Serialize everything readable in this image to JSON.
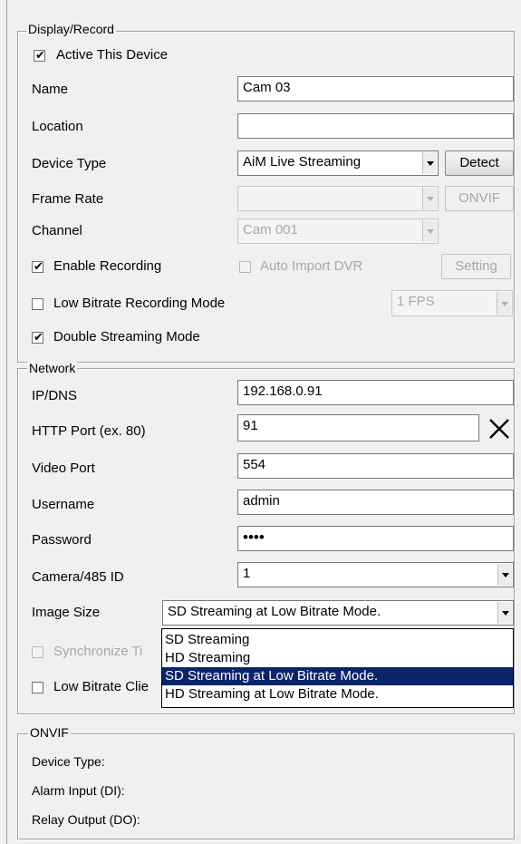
{
  "display_record": {
    "legend": "Display/Record",
    "active_device": {
      "label": "Active This Device",
      "checked": true
    },
    "name": {
      "label": "Name",
      "value": "Cam 03"
    },
    "location": {
      "label": "Location",
      "value": ""
    },
    "device_type": {
      "label": "Device Type",
      "value": "AiM Live Streaming",
      "detect_label": "Detect"
    },
    "frame_rate": {
      "label": "Frame Rate",
      "value": "",
      "onvif_label": "ONVIF"
    },
    "channel": {
      "label": "Channel",
      "value": "Cam 001"
    },
    "enable_recording": {
      "label": "Enable Recording",
      "checked": true
    },
    "auto_import": {
      "label": "Auto Import DVR",
      "checked": false
    },
    "setting_label": "Setting",
    "low_bitrate_recording": {
      "label": "Low Bitrate Recording Mode",
      "checked": false,
      "fps_value": "1 FPS"
    },
    "double_streaming": {
      "label": "Double Streaming Mode",
      "checked": true
    }
  },
  "network": {
    "legend": "Network",
    "ip": {
      "label": "IP/DNS",
      "value": "192.168.0.91"
    },
    "http_port": {
      "label": "HTTP Port (ex. 80)",
      "value": "91"
    },
    "video_port": {
      "label": "Video Port",
      "value": "554"
    },
    "username": {
      "label": "Username",
      "value": "admin"
    },
    "password": {
      "label": "Password",
      "value": "••••"
    },
    "camera_id": {
      "label": "Camera/485 ID",
      "value": "1"
    },
    "image_size": {
      "label": "Image Size",
      "value": "SD Streaming at Low Bitrate Mode.",
      "options": [
        "SD Streaming",
        "HD Streaming",
        "SD Streaming at Low Bitrate Mode.",
        "HD Streaming at Low Bitrate Mode."
      ],
      "selected_index": 2
    },
    "synchronize_partial": "Synchronize Ti",
    "low_bitrate_client_partial": "Low Bitrate Clie"
  },
  "onvif": {
    "legend": "ONVIF",
    "device_type_label": "Device Type:",
    "alarm_input_label": "Alarm Input (DI):",
    "relay_output_label": "Relay Output (DO):"
  }
}
